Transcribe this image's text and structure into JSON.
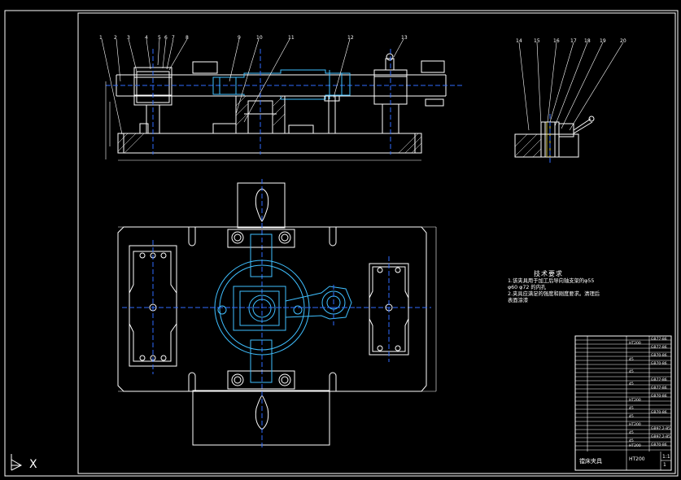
{
  "drawing": {
    "part_labels_front": [
      "1",
      "2",
      "3",
      "4",
      "5",
      "6",
      "7",
      "8",
      "9",
      "10",
      "11",
      "12",
      "13"
    ],
    "part_labels_side": [
      "14",
      "15",
      "16",
      "17",
      "18",
      "19",
      "20"
    ],
    "tech_requirements": {
      "heading": "技术要求",
      "line1": "1.该夹具用于加工后导向轴支架的φ55",
      "line2": "φ60 φ72 的内孔",
      "line3": "2.夹具应满足的强度和刚度要求。清理后",
      "line4": "表面涂漆"
    },
    "title_block": {
      "name": "镗床夹具",
      "material": "HT200",
      "scale": "1:1",
      "sheet": "1",
      "codes": [
        "GB77-86",
        "GB77-86",
        "GB70-86",
        "GB70-86",
        "GB77-86",
        "GB77-86",
        "GB70-86",
        "GB70-86",
        "GB97.2-85",
        "GB97.2-85",
        "GB70-86"
      ],
      "materials": [
        "HT200",
        "45",
        "45",
        "45",
        "HT200",
        "45",
        "45",
        "HT200",
        "45",
        "45",
        "HT200"
      ]
    },
    "axis_marker": "X",
    "colors": {
      "background": "#000000",
      "outline": "#ffffff",
      "centerline": "#2f6cff",
      "section": "#3fbfff"
    }
  }
}
